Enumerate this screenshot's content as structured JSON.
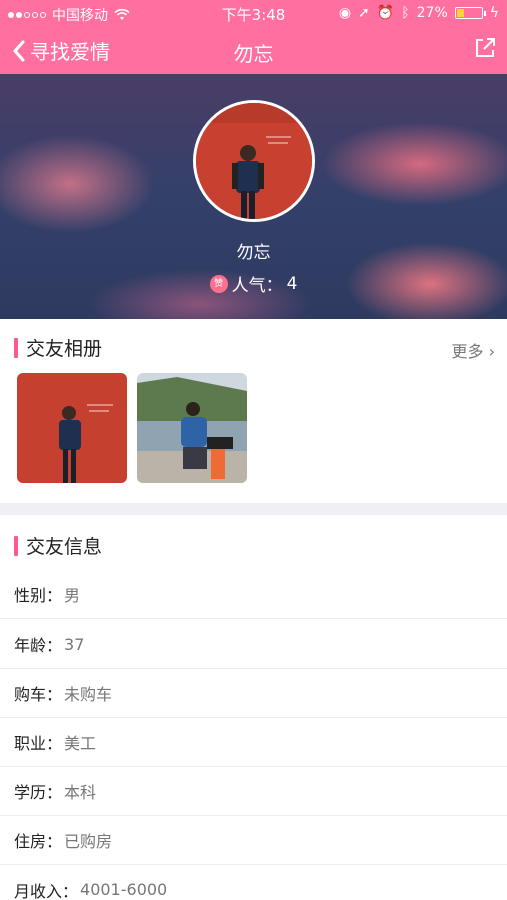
{
  "status_bar": {
    "carrier": "中国移动",
    "time": "下午3:48",
    "battery_text": "27%"
  },
  "navbar": {
    "back_label": "寻找爱情",
    "title": "勿忘"
  },
  "profile": {
    "name": "勿忘",
    "popularity_label": "人气：",
    "popularity_value": "4",
    "badge": "赞"
  },
  "album": {
    "title": "交友相册",
    "more_label": "更多 ›"
  },
  "info": {
    "title": "交友信息",
    "rows": [
      {
        "key": "性别：",
        "value": "男"
      },
      {
        "key": "年龄：",
        "value": "37"
      },
      {
        "key": "购车：",
        "value": "未购车"
      },
      {
        "key": "职业：",
        "value": "美工"
      },
      {
        "key": "学历：",
        "value": "本科"
      },
      {
        "key": "住房：",
        "value": "已购房"
      },
      {
        "key": "月收入：",
        "value": "4001-6000"
      }
    ]
  }
}
